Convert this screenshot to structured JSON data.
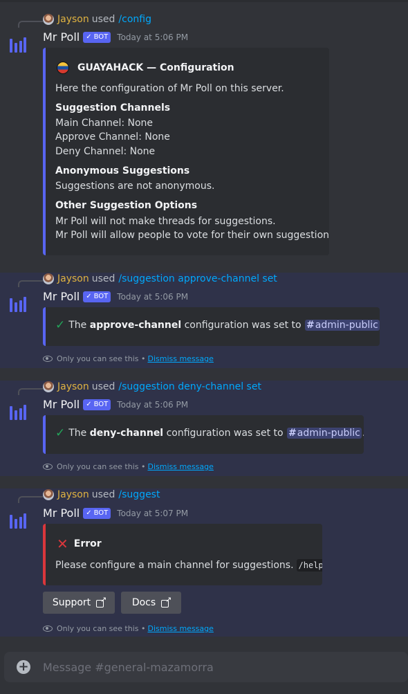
{
  "messages": [
    {
      "reply": {
        "user": "Jayson",
        "used": "used",
        "command": "/config"
      },
      "bot": {
        "name": "Mr Poll",
        "badge": "BOT",
        "time": "Today at 5:06 PM"
      },
      "embed": {
        "title": "GUAYAHACK — Configuration",
        "description": "Here the configuration of Mr Poll on this server.",
        "sections": [
          {
            "name": "Suggestion Channels",
            "lines": [
              "Main Channel: None",
              "Approve Channel: None",
              "Deny Channel: None"
            ]
          },
          {
            "name": "Anonymous Suggestions",
            "lines": [
              "Suggestions are not anonymous."
            ]
          },
          {
            "name": "Other Suggestion Options",
            "lines": [
              "Mr Poll will not make threads for suggestions.",
              "Mr Poll will allow people to vote for their own suggestion."
            ]
          }
        ]
      }
    },
    {
      "reply": {
        "user": "Jayson",
        "used": "used",
        "command": "/suggestion approve-channel set"
      },
      "bot": {
        "name": "Mr Poll",
        "badge": "BOT",
        "time": "Today at 5:06 PM"
      },
      "embed": {
        "pre": "The",
        "bold": "approve-channel",
        "mid": "configuration was set to",
        "channel": "admin-public",
        "post": "."
      },
      "ephemeral": {
        "text": "Only you can see this •",
        "dismiss": "Dismiss message"
      }
    },
    {
      "reply": {
        "user": "Jayson",
        "used": "used",
        "command": "/suggestion deny-channel set"
      },
      "bot": {
        "name": "Mr Poll",
        "badge": "BOT",
        "time": "Today at 5:06 PM"
      },
      "embed": {
        "pre": "The",
        "bold": "deny-channel",
        "mid": "configuration was set to",
        "channel": "admin-public",
        "post": "."
      },
      "ephemeral": {
        "text": "Only you can see this •",
        "dismiss": "Dismiss message"
      }
    },
    {
      "reply": {
        "user": "Jayson",
        "used": "used",
        "command": "/suggest"
      },
      "bot": {
        "name": "Mr Poll",
        "badge": "BOT",
        "time": "Today at 5:07 PM"
      },
      "embed": {
        "title": "Error",
        "text": "Please configure a main channel for suggestions.",
        "code": "/help"
      },
      "buttons": [
        "Support",
        "Docs"
      ],
      "ephemeral": {
        "text": "Only you can see this •",
        "dismiss": "Dismiss message"
      }
    }
  ],
  "composer": {
    "placeholder": "Message #general-mazamorra"
  },
  "colors": {
    "blurple": "#5865f2",
    "error": "#da373c",
    "success": "#23a55a",
    "username": "#e0b341",
    "link": "#00a8fc"
  }
}
